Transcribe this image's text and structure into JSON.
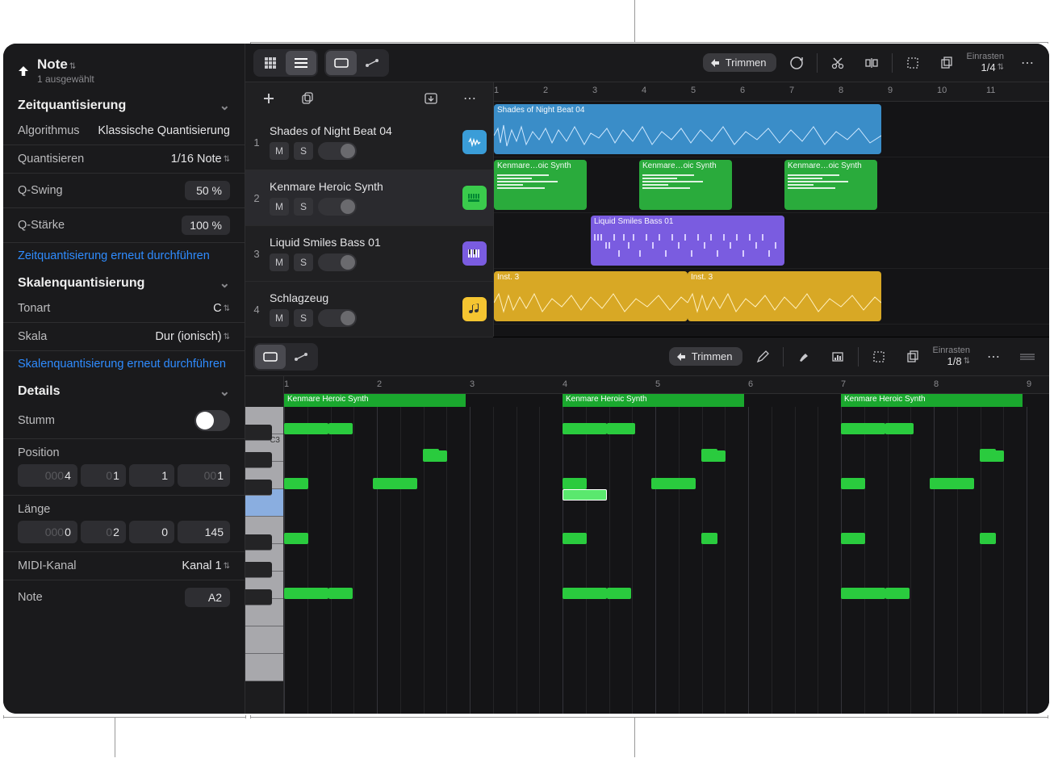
{
  "header": {
    "title": "Note",
    "subtitle": "1 ausgewählt"
  },
  "timeQuant": {
    "title": "Zeitquantisierung",
    "algorithm_lbl": "Algorithmus",
    "algorithm_val": "Klassische Quantisierung",
    "quantize_lbl": "Quantisieren",
    "quantize_val": "1/16 Note",
    "qswing_lbl": "Q-Swing",
    "qswing_val": "50 %",
    "qstrength_lbl": "Q-Stärke",
    "qstrength_val": "100 %",
    "redo": "Zeitquantisierung erneut durchführen"
  },
  "scaleQuant": {
    "title": "Skalenquantisierung",
    "key_lbl": "Tonart",
    "key_val": "C",
    "scale_lbl": "Skala",
    "scale_val": "Dur (ionisch)",
    "redo": "Skalenquantisierung erneut durchführen"
  },
  "details": {
    "title": "Details",
    "mute_lbl": "Stumm",
    "position_lbl": "Position",
    "position": [
      "4",
      "1",
      "1",
      "1"
    ],
    "position_pad": [
      "000",
      "0",
      "",
      ""
    ],
    "length_lbl": "Länge",
    "length": [
      "0",
      "2",
      "0",
      "145"
    ],
    "length_pad": [
      "000",
      "0",
      "",
      ""
    ],
    "midi_lbl": "MIDI-Kanal",
    "midi_val": "Kanal 1",
    "note_lbl": "Note",
    "note_val": "A2"
  },
  "toolbar": {
    "trim": "Trimmen",
    "snap_lbl": "Einrasten",
    "snap_val_top": "1/4",
    "snap_val_bot": "1/8"
  },
  "tracks": [
    {
      "num": "1",
      "name": "Shades of Night Beat 04",
      "color": "blue"
    },
    {
      "num": "2",
      "name": "Kenmare Heroic Synth",
      "color": "green"
    },
    {
      "num": "3",
      "name": "Liquid Smiles Bass 01",
      "color": "purple"
    },
    {
      "num": "4",
      "name": "Schlagzeug",
      "color": "yellow"
    }
  ],
  "rulerTop": [
    "1",
    "2",
    "3",
    "4",
    "5",
    "6",
    "7",
    "8",
    "9",
    "10",
    "11"
  ],
  "regions": {
    "track1": {
      "name": "Shades of Night Beat 04"
    },
    "track2": {
      "name": "Kenmare…oic Synth"
    },
    "track3": {
      "name": "Liquid Smiles Bass 01"
    },
    "track4": {
      "name": "Inst. 3"
    }
  },
  "pianoRuler": [
    "1",
    "2",
    "3",
    "4",
    "5",
    "6",
    "7",
    "8",
    "9"
  ],
  "pianoRegionName": "Kenmare Heroic Synth",
  "keyLabel": "C3"
}
